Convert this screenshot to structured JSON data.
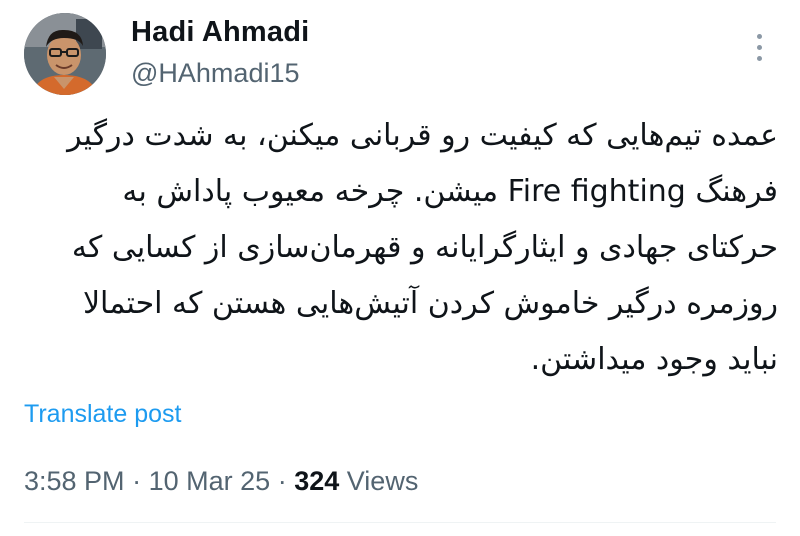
{
  "author": {
    "display_name": "Hadi Ahmadi",
    "handle": "@HAhmadi15"
  },
  "tweet": {
    "text": "عمده تیم‌هایی که کیفیت رو قربانی میکنن، به شدت درگیر\nفرهنگ Fire fighting میشن. چرخه معیوب پاداش به\nحرکتای جهادی و ایثارگرایانه و قهرمان‌سازی از کسایی که\nروزمره درگیر خاموش کردن آتیش‌هایی هستن که احتمالا\nنباید وجود میداشتن."
  },
  "actions": {
    "translate_label": "Translate post",
    "more_icon": "vertical-ellipsis-icon"
  },
  "meta": {
    "time": "3:58 PM",
    "separator": "·",
    "date": "10 Mar 25",
    "views_count": "324",
    "views_label": "Views"
  },
  "colors": {
    "link": "#1d9bf0",
    "secondary_text": "#536471",
    "primary_text": "#0f1419"
  }
}
